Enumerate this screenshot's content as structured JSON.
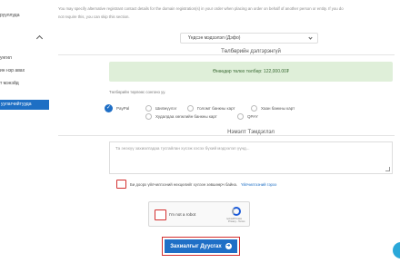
{
  "sidebar": {
    "items": [
      {
        "label": "рууллуда"
      },
      {
        "label": "унгил"
      },
      {
        "label": "ин нэр авах"
      },
      {
        "label": "т мэнэйд"
      }
    ],
    "active_label": "уулагчийтууда"
  },
  "intro_text": "You may specify alternative registrant contact details for the domain registration(s) in your order when placing an order on behalf of another person or entity. If you do not require this, you can skip this section.",
  "contact_select": {
    "value": "Үндсэн мэдээлэл (Дэфо)"
  },
  "payment": {
    "title": "Төлбөрийн дэлгэрэнгүй",
    "amount_text": "Өнөөдөр төлөх төлбөр:  122,000.00₮",
    "method_note": "Төлбөрийн төрлөөс сонгоно уу.",
    "methods": [
      {
        "label": "PayPal",
        "checked": true
      },
      {
        "label": "Шилжүүлэг",
        "checked": false
      },
      {
        "label": "Голомт банкны карт",
        "checked": false
      },
      {
        "label": "Хаан банкны карт",
        "checked": false
      },
      {
        "label": "Худалдаа хөгжлийн банкны карт",
        "checked": false
      },
      {
        "label": "QPAY",
        "checked": false
      }
    ]
  },
  "notes": {
    "title": "Нэмэлт Тэмдэглэл",
    "placeholder": "Та энэхүү захиалгадаа тусгайлан хүсэж хэсэх бүхий мэдээлэл үүнд..."
  },
  "terms": {
    "text": "Би доорх үйлчилгээний нөхцөлийг хүлээн зөвшөөрч байна.",
    "link_label": "Үйлчилгээний гэрээ"
  },
  "captcha": {
    "label": "I'm not a robot",
    "brand": "reCAPTCHA",
    "links": "Privacy - Terms"
  },
  "submit": {
    "label": "Захиалгыг Дуусгах"
  }
}
